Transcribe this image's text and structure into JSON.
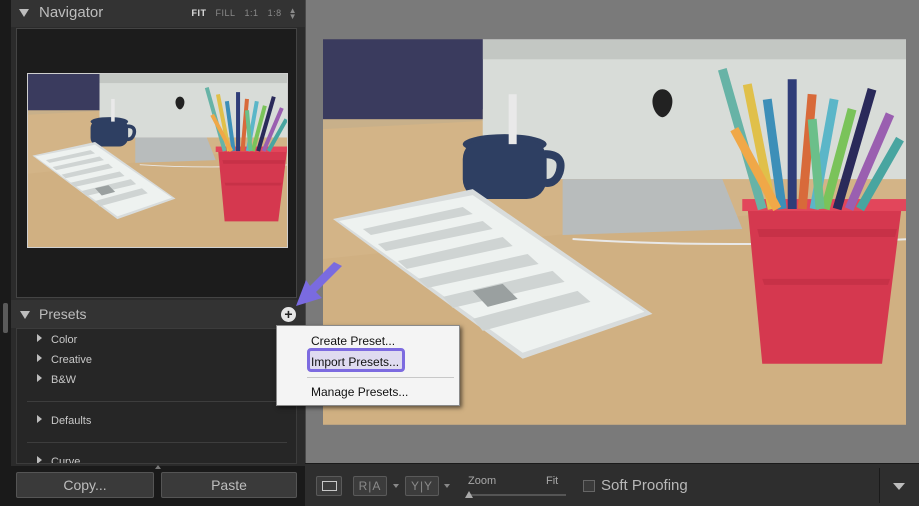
{
  "navigator": {
    "title": "Navigator",
    "modes": [
      "FIT",
      "FILL",
      "1:1",
      "1:8"
    ],
    "active_mode": "FIT"
  },
  "presets": {
    "title": "Presets",
    "add_icon": "plus-icon",
    "folders": [
      "Color",
      "Creative",
      "B&W",
      "Defaults",
      "Curve"
    ]
  },
  "context_menu": {
    "items": [
      "Create Preset...",
      "Import Presets...",
      "Manage Presets..."
    ],
    "highlighted": "Import Presets..."
  },
  "bottom_buttons": {
    "copy": "Copy...",
    "paste": "Paste"
  },
  "toolbar": {
    "ra_label": "R|A",
    "yy_label": "Y|Y",
    "zoom_label": "Zoom",
    "fit_label": "Fit",
    "soft_proofing_label": "Soft Proofing"
  },
  "colors": {
    "highlight": "#7d6be0",
    "pointer_arrow": "#7a6be0"
  }
}
